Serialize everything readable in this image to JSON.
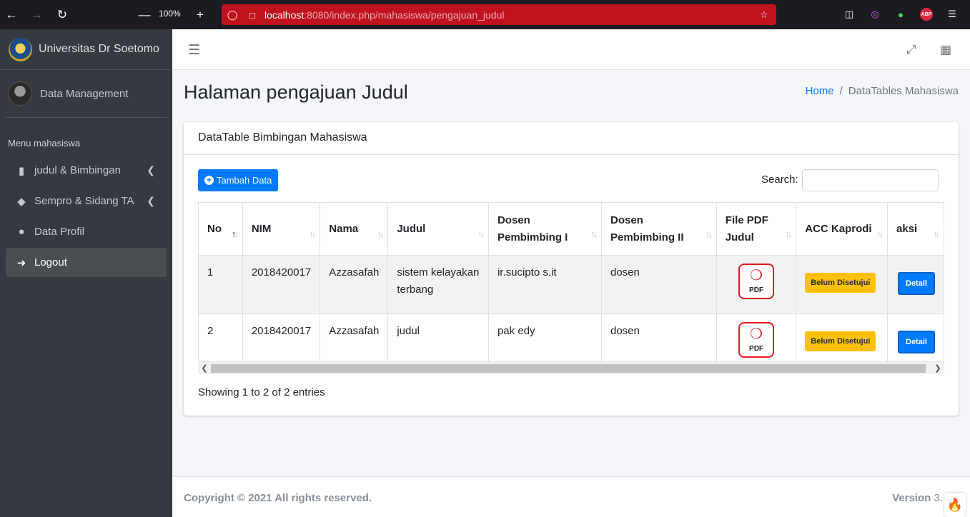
{
  "browser": {
    "zoom": "100%",
    "url_host": "localhost",
    "url_rest": ":8080/index.php/mahasiswa/pengajuan_judul"
  },
  "sidebar": {
    "brand": "Universitas Dr Soetomo",
    "user": "Data Management",
    "menu_header": "Menu mahasiswa",
    "items": [
      {
        "label": "judul & Bimbingan",
        "icon": "book-icon"
      },
      {
        "label": "Sempro & Sidang TA",
        "icon": "graduation-cap-icon"
      },
      {
        "label": "Data Profil",
        "icon": "user-icon"
      },
      {
        "label": "Logout",
        "icon": "sign-out-icon"
      }
    ]
  },
  "content": {
    "title": "Halaman pengajuan Judul",
    "breadcrumb_home": "Home",
    "breadcrumb_sep": "/",
    "breadcrumb_current": "DataTables Mahasiswa"
  },
  "card": {
    "title": "DataTable Bimbingan Mahasiswa",
    "add_button": "Tambah Data",
    "search_label": "Search:",
    "search_value": "",
    "info": "Showing 1 to 2 of 2 entries"
  },
  "table": {
    "headers": [
      "No",
      "NIM",
      "Nama",
      "Judul",
      "Dosen Pembimbing I",
      "Dosen Pembimbing II",
      "File PDF Judul",
      "ACC Kaprodi",
      "aksi"
    ],
    "rows": [
      {
        "no": "1",
        "nim": "2018420017",
        "nama": "Azzasafah",
        "judul": "sistem kelayakan terbang",
        "dosen1": "ir.sucipto s.it",
        "dosen2": "dosen",
        "pdf": "PDF",
        "status": "Belum Disetujui",
        "action": "Detail"
      },
      {
        "no": "2",
        "nim": "2018420017",
        "nama": "Azzasafah",
        "judul": "judul",
        "dosen1": "pak edy",
        "dosen2": "dosen",
        "pdf": "PDF",
        "status": "Belum Disetujui",
        "action": "Detail"
      }
    ]
  },
  "footer": {
    "copyright": "Copyright © 2021 All rights reserved.",
    "version_label": "Version",
    "version_value": "3."
  },
  "colors": {
    "sidebar_bg": "#343a40",
    "primary": "#007bff",
    "warning": "#ffc107",
    "url_bar": "#c0121c"
  }
}
